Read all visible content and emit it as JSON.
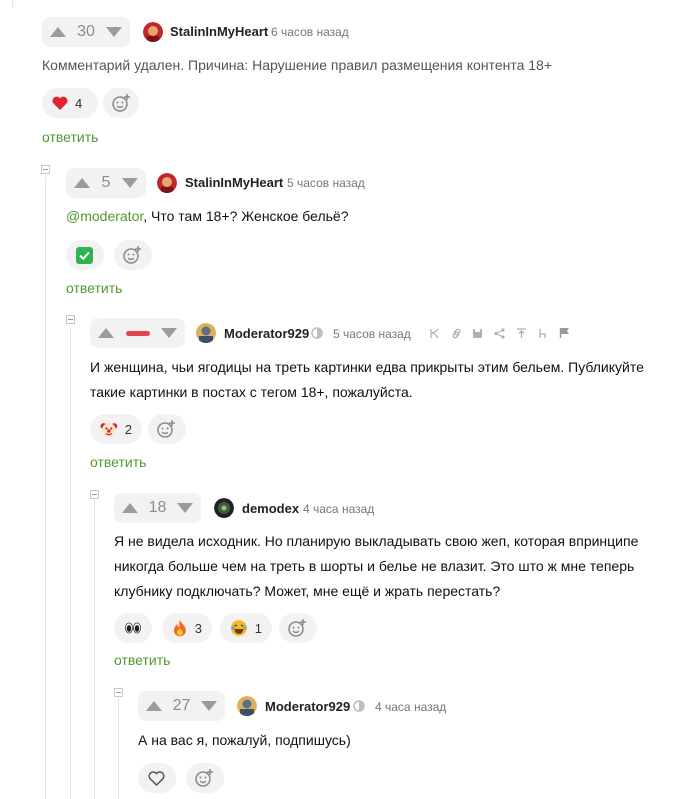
{
  "comments": [
    {
      "rating": "30",
      "username": "StalinInMyHeart",
      "time": "6 часов назад",
      "text": "Комментарий удален. Причина: Нарушение правил размещения контента 18+",
      "reactions": [
        {
          "icon": "heart-icon",
          "count": "4"
        }
      ],
      "reply_label": "ответить"
    },
    {
      "rating": "5",
      "username": "StalinInMyHeart",
      "time": "5 часов назад",
      "mention": "@moderator",
      "text": ", Что там 18+? Женское бельё?",
      "reactions": [
        {
          "icon": "checkmark-icon",
          "count": ""
        }
      ],
      "reply_label": "ответить"
    },
    {
      "rating": "",
      "username": "Moderator929",
      "time": "5 часов назад",
      "text_line1": "И женщина, чьи ягодицы на треть картинки едва прикрыты этим бельем. Публикуйте",
      "text_line2": "такие картинки в постах с тегом 18+, пожалуйста.",
      "reactions": [
        {
          "icon": "clown-icon",
          "count": "2"
        }
      ],
      "reply_label": "ответить"
    },
    {
      "rating": "18",
      "username": "demodex",
      "time": "4 часа назад",
      "text_line1": "Я не видела исходник. Но планирую выкладывать свою жеп, которая впринципе",
      "text_line2": "никогда больше чем на треть в шорты и белье не влазит. Это што ж мне теперь",
      "text_line3": "клубнику подключать? Может, мне ещё и жрать перестать?",
      "reactions": [
        {
          "icon": "eyes-icon",
          "count": ""
        },
        {
          "icon": "fire-icon",
          "count": "3"
        },
        {
          "icon": "laughing-icon",
          "count": "1"
        }
      ],
      "reply_label": "ответить"
    },
    {
      "rating": "27",
      "username": "Moderator929",
      "time": "4 часа назад",
      "text": "А на вас я, пожалуй, подпишусь)",
      "reactions": [
        {
          "icon": "heart-outline-icon",
          "count": ""
        }
      ]
    }
  ],
  "colors": {
    "accent_green": "#4f9a2c",
    "minus_red": "#e4464f",
    "heart_red": "#e0242f"
  }
}
